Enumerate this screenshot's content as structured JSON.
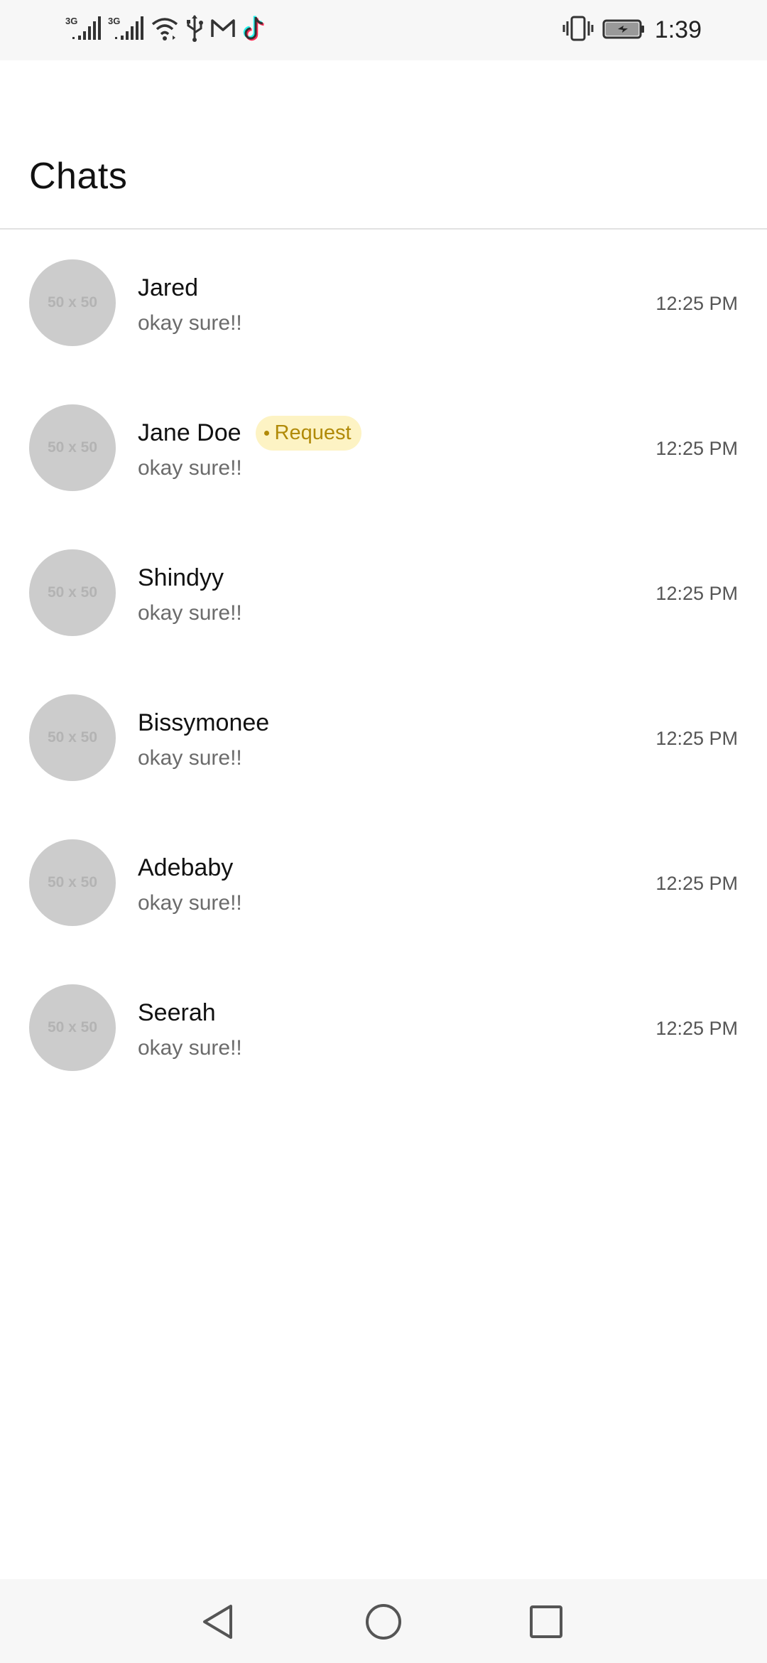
{
  "status_bar": {
    "time": "1:39",
    "network_1": "3G",
    "network_2": "3G",
    "icons_left": [
      "signal-3g-icon",
      "signal-3g-icon",
      "wifi-icon",
      "usb-icon",
      "gmail-icon",
      "tiktok-icon"
    ],
    "icons_right": [
      "vibrate-icon",
      "battery-charging-icon"
    ]
  },
  "header": {
    "title": "Chats"
  },
  "chats": [
    {
      "name": "Jared",
      "preview": "okay sure!!",
      "time": "12:25 PM",
      "avatar_text": "50 x 50",
      "badge": ""
    },
    {
      "name": "Jane Doe",
      "preview": "okay sure!!",
      "time": "12:25 PM",
      "avatar_text": "50 x 50",
      "badge": "Request"
    },
    {
      "name": "Shindyy",
      "preview": "okay sure!!",
      "time": "12:25 PM",
      "avatar_text": "50 x 50",
      "badge": ""
    },
    {
      "name": "Bissymonee",
      "preview": "okay sure!!",
      "time": "12:25 PM",
      "avatar_text": "50 x 50",
      "badge": ""
    },
    {
      "name": "Adebaby",
      "preview": "okay sure!!",
      "time": "12:25 PM",
      "avatar_text": "50 x 50",
      "badge": ""
    },
    {
      "name": "Seerah",
      "preview": "okay sure!!",
      "time": "12:25 PM",
      "avatar_text": "50 x 50",
      "badge": ""
    }
  ],
  "nav_bar": {
    "buttons": [
      "back-icon",
      "home-icon",
      "recents-icon"
    ]
  },
  "colors": {
    "badge_bg": "#fdf3c4",
    "badge_text": "#b18a08",
    "avatar_bg": "#cccccc"
  }
}
